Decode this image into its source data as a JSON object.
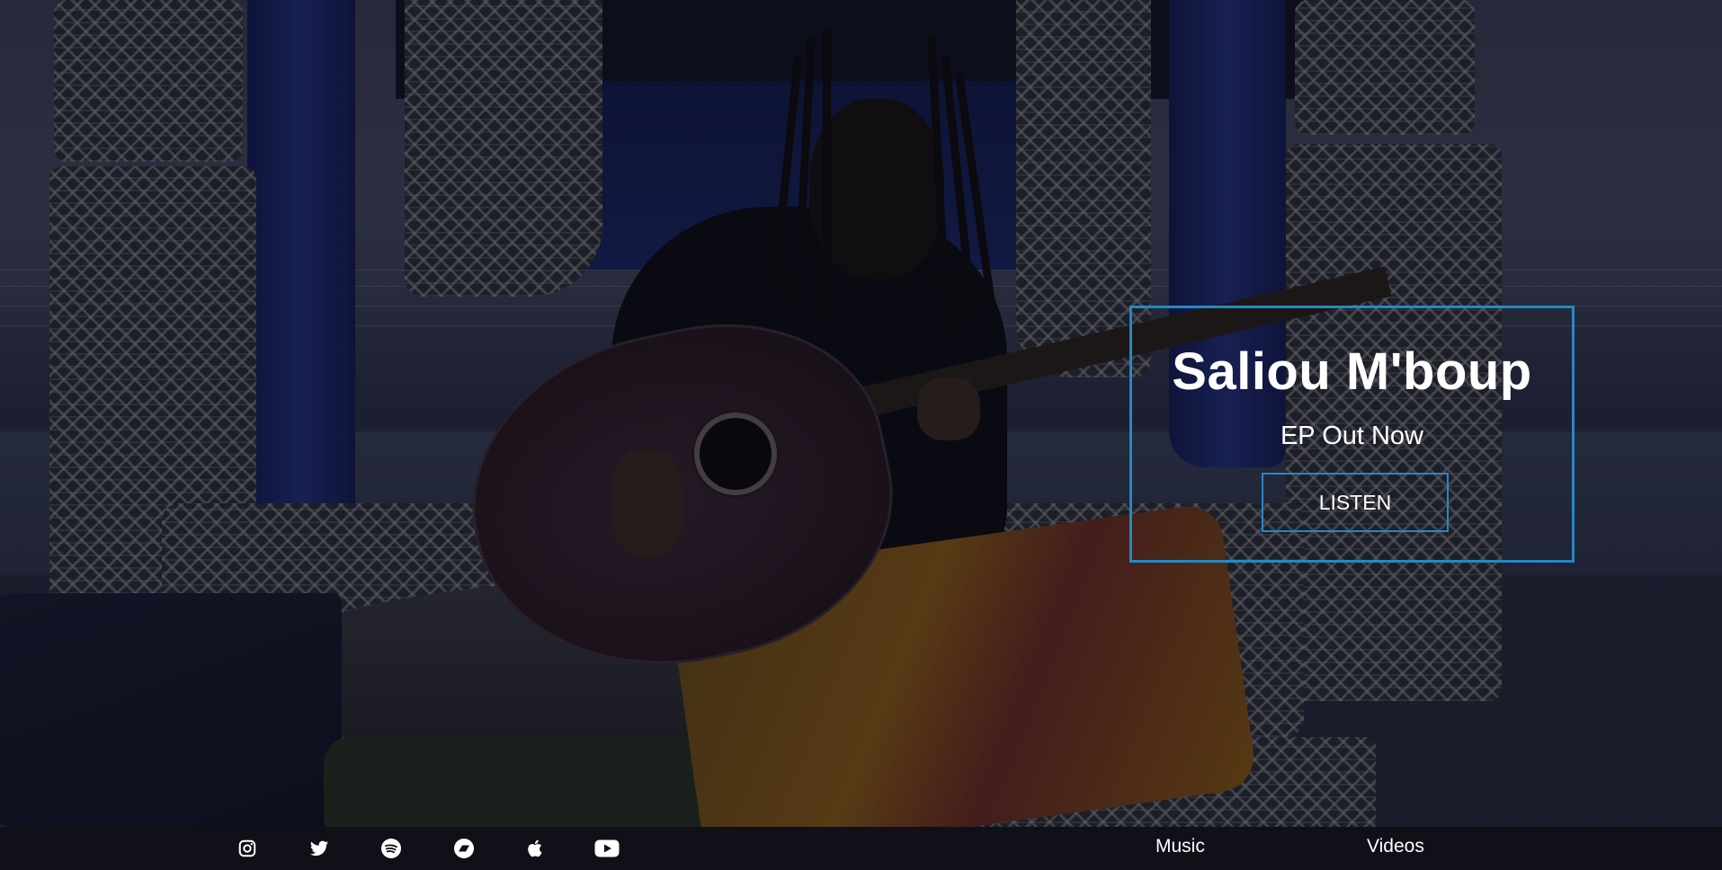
{
  "promo": {
    "title": "Saliou M'boup",
    "subtitle": "EP Out Now",
    "button_label": "LISTEN",
    "accent_color": "#2489c4"
  },
  "footer": {
    "social_icons": [
      "instagram-icon",
      "twitter-icon",
      "spotify-icon",
      "bandcamp-icon",
      "apple-music-icon",
      "youtube-icon"
    ],
    "nav": {
      "music": "Music",
      "videos": "Videos"
    }
  }
}
